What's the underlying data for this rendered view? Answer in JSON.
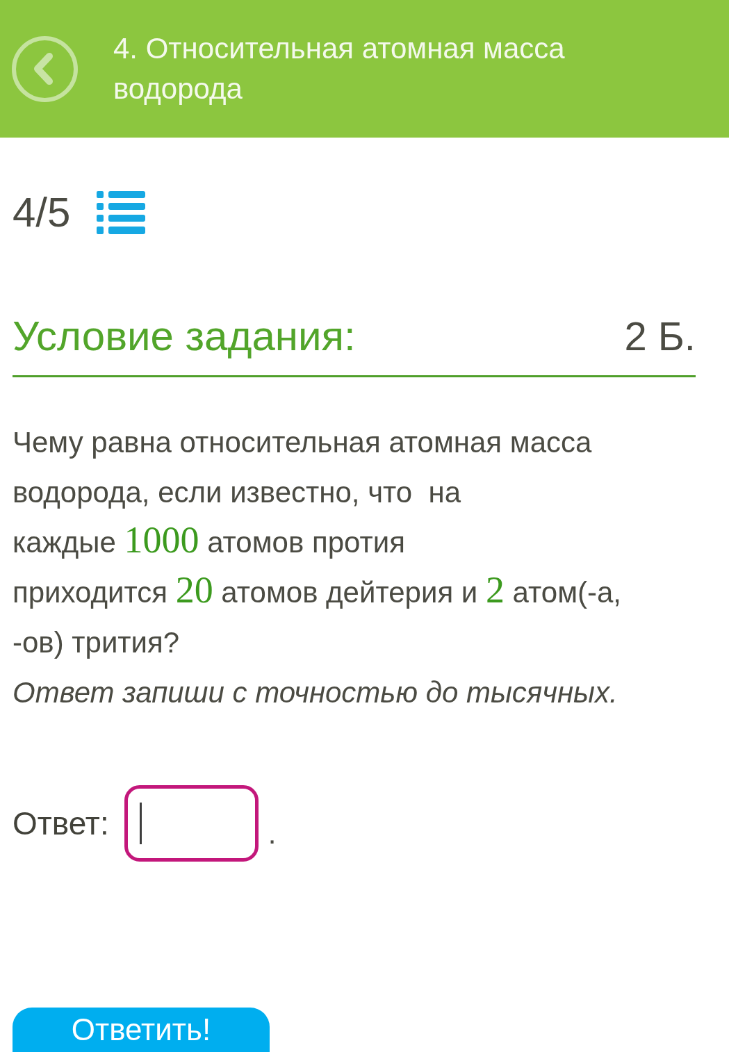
{
  "header": {
    "title": "4. Относительная атомная масса водорода"
  },
  "progress": {
    "text": "4/5"
  },
  "task": {
    "heading": "Условие задания:",
    "points": "2 Б.",
    "question_lines": [
      [
        {
          "kind": "text",
          "text": "Чему равна относительная атомная масса"
        }
      ],
      [
        {
          "kind": "text",
          "text": "водорода, если известно, что  на"
        }
      ],
      [
        {
          "kind": "text",
          "text": "каждые "
        },
        {
          "kind": "number",
          "text": "1000"
        },
        {
          "kind": "text",
          "text": " атомов протия"
        }
      ],
      [
        {
          "kind": "text",
          "text": "приходится "
        },
        {
          "kind": "number",
          "text": "20"
        },
        {
          "kind": "text",
          "text": " атомов дейтерия и "
        },
        {
          "kind": "number",
          "text": "2"
        },
        {
          "kind": "text",
          "text": " атом(-а,"
        }
      ],
      [
        {
          "kind": "text",
          "text": "-ов) трития?"
        }
      ]
    ],
    "instruction": "Ответ запиши с точностью до тысячных."
  },
  "answer": {
    "label": "Ответ:",
    "focused": true,
    "suffix": "."
  },
  "submit_button": {
    "label": "Ответить!"
  }
}
